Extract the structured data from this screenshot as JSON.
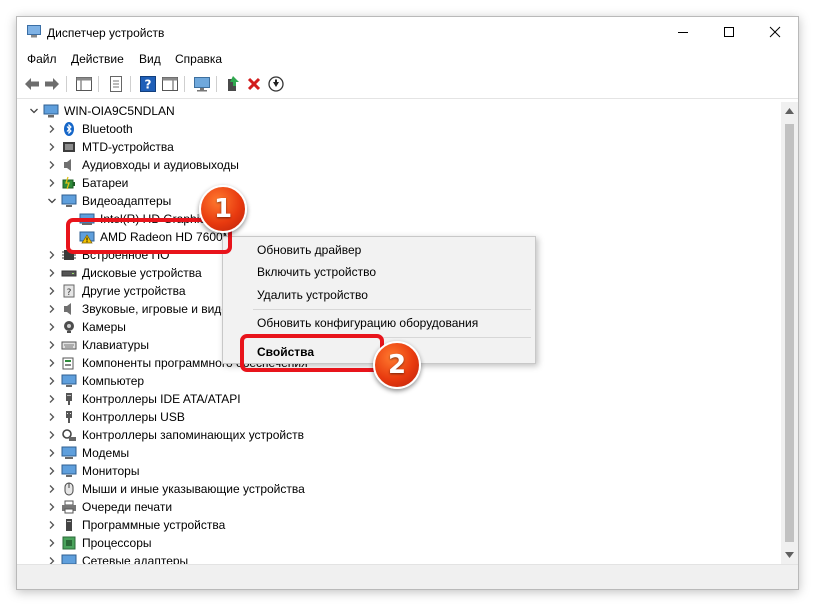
{
  "window": {
    "title": "Диспетчер устройств"
  },
  "menu": [
    "Файл",
    "Действие",
    "Вид",
    "Справка"
  ],
  "tree": {
    "root": "WIN-OIA9C5NDLAN",
    "items": [
      {
        "label": "Bluetooth",
        "icon": "bluetooth-icon"
      },
      {
        "label": "MTD-устройства",
        "icon": "mtd-device-icon"
      },
      {
        "label": "Аудиовходы и аудиовыходы",
        "icon": "speaker-icon"
      },
      {
        "label": "Батареи",
        "icon": "battery-icon"
      },
      {
        "label": "Видеоадаптеры",
        "icon": "monitor-icon"
      },
      {
        "label": "Intel(R) HD Graphics",
        "icon": "display-adapter-icon"
      },
      {
        "label": "AMD Radeon HD 7600M",
        "icon": "display-adapter-warning-icon"
      },
      {
        "label": "Встроенное ПО",
        "icon": "chip-icon"
      },
      {
        "label": "Дисковые устройства",
        "icon": "disk-icon"
      },
      {
        "label": "Другие устройства",
        "icon": "unknown-device-icon"
      },
      {
        "label": "Звуковые, игровые и видеоустройства",
        "icon": "speaker-icon"
      },
      {
        "label": "Камеры",
        "icon": "camera-icon"
      },
      {
        "label": "Клавиатуры",
        "icon": "keyboard-icon"
      },
      {
        "label": "Компоненты программного обеспечения",
        "icon": "software-component-icon"
      },
      {
        "label": "Компьютер",
        "icon": "computer-icon"
      },
      {
        "label": "Контроллеры IDE ATA/ATAPI",
        "icon": "ide-controller-icon"
      },
      {
        "label": "Контроллеры USB",
        "icon": "usb-icon"
      },
      {
        "label": "Контроллеры запоминающих устройств",
        "icon": "storage-controller-icon"
      },
      {
        "label": "Модемы",
        "icon": "modem-icon"
      },
      {
        "label": "Мониторы",
        "icon": "monitor-icon"
      },
      {
        "label": "Мыши и иные указывающие устройства",
        "icon": "mouse-icon"
      },
      {
        "label": "Очереди печати",
        "icon": "printer-icon"
      },
      {
        "label": "Программные устройства",
        "icon": "software-device-icon"
      },
      {
        "label": "Процессоры",
        "icon": "processor-icon"
      },
      {
        "label": "Сетевые адаптеры",
        "icon": "network-adapter-icon"
      }
    ]
  },
  "context_menu": {
    "items": [
      "Обновить драйвер",
      "Включить устройство",
      "Удалить устройство",
      "Обновить конфигурацию оборудования",
      "Свойства"
    ]
  },
  "annotations": {
    "badge1": "1",
    "badge2": "2"
  },
  "colors": {
    "highlight": "#e8141b",
    "badge": "#e83a0f",
    "folder_blue": "#1f6fc2"
  }
}
